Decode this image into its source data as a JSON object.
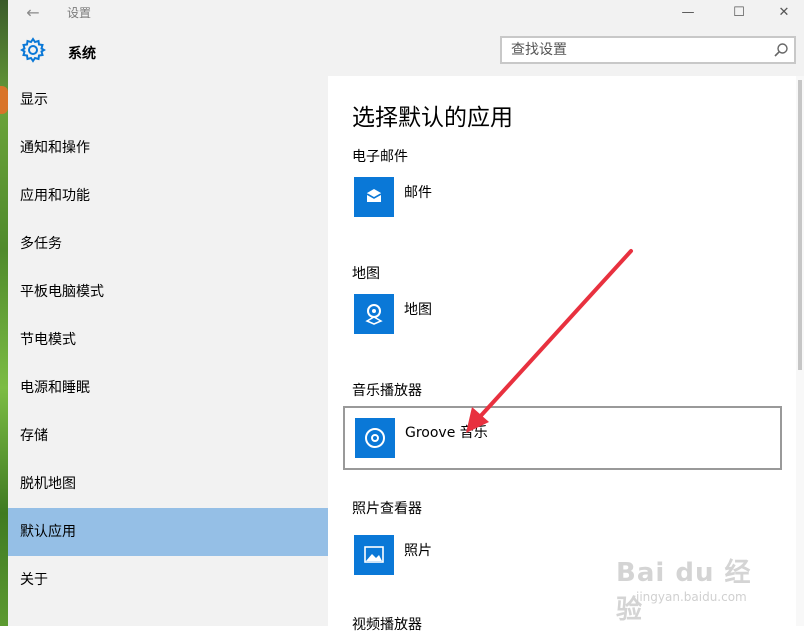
{
  "window": {
    "title": "设置",
    "back_glyph": "←",
    "minimize_glyph": "—",
    "maximize_glyph": "☐",
    "close_glyph": "✕"
  },
  "header": {
    "section_icon": "gear-icon",
    "section_title": "系统",
    "search_placeholder": "查找设置",
    "search_value": "",
    "search_icon": "search-icon"
  },
  "sidebar": {
    "items": [
      {
        "label": "显示",
        "selected": false
      },
      {
        "label": "通知和操作",
        "selected": false
      },
      {
        "label": "应用和功能",
        "selected": false
      },
      {
        "label": "多任务",
        "selected": false
      },
      {
        "label": "平板电脑模式",
        "selected": false
      },
      {
        "label": "节电模式",
        "selected": false
      },
      {
        "label": "电源和睡眠",
        "selected": false
      },
      {
        "label": "存储",
        "selected": false
      },
      {
        "label": "脱机地图",
        "selected": false
      },
      {
        "label": "默认应用",
        "selected": true
      },
      {
        "label": "关于",
        "selected": false
      }
    ]
  },
  "main": {
    "title": "选择默认的应用",
    "categories": [
      {
        "label": "电子邮件",
        "app": "邮件",
        "icon": "mail-icon"
      },
      {
        "label": "地图",
        "app": "地图",
        "icon": "maps-icon"
      },
      {
        "label": "音乐播放器",
        "app": "Groove 音乐",
        "icon": "groove-music-icon",
        "focused": true
      },
      {
        "label": "照片查看器",
        "app": "照片",
        "icon": "photos-icon"
      },
      {
        "label": "视频播放器"
      }
    ]
  },
  "watermark": {
    "brand": "Bai du 经验",
    "url": "jingyan.baidu.com"
  },
  "colors": {
    "accent": "#0a78d7",
    "selected_nav": "#95bfe6",
    "chrome": "#f2f2f2",
    "annotation_arrow": "#e8313f"
  }
}
